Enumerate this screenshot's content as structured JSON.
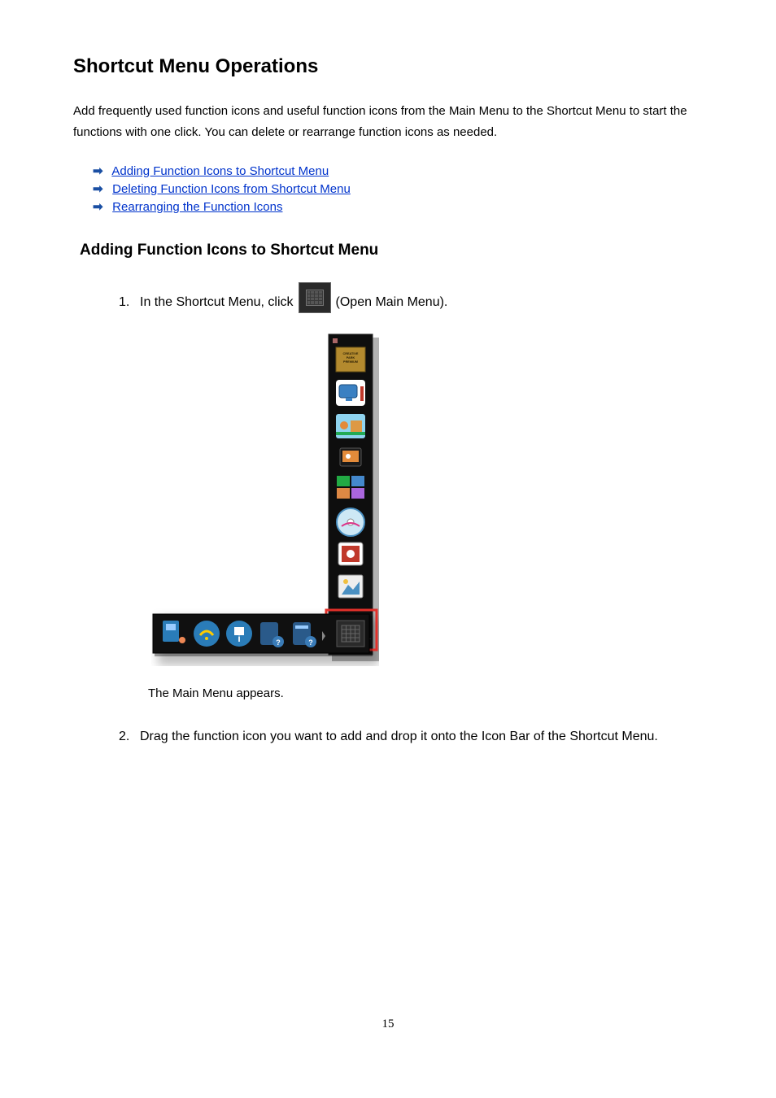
{
  "title": "Shortcut Menu Operations",
  "intro": "Add frequently used function icons and useful function icons from the Main Menu to the Shortcut Menu to start the functions with one click. You can delete or rearrange function icons as needed.",
  "links": [
    {
      "label": "Adding Function Icons to Shortcut Menu"
    },
    {
      "label": "Deleting Function Icons from Shortcut Menu"
    },
    {
      "label": "Rearranging the Function Icons"
    }
  ],
  "subheading": "Adding Function Icons to Shortcut Menu",
  "steps": {
    "s1": {
      "num": "1.",
      "pre": "In the Shortcut Menu, click",
      "post": "(Open Main Menu).",
      "caption": "The Main Menu appears."
    },
    "s2": {
      "num": "2.",
      "text": "Drag the function icon you want to add and drop it onto the Icon Bar of the Shortcut Menu."
    }
  },
  "icons": {
    "arrow_glyph": "➡",
    "creative_park": "CREATIVE PARK PREMIUM"
  },
  "page_number": "15"
}
